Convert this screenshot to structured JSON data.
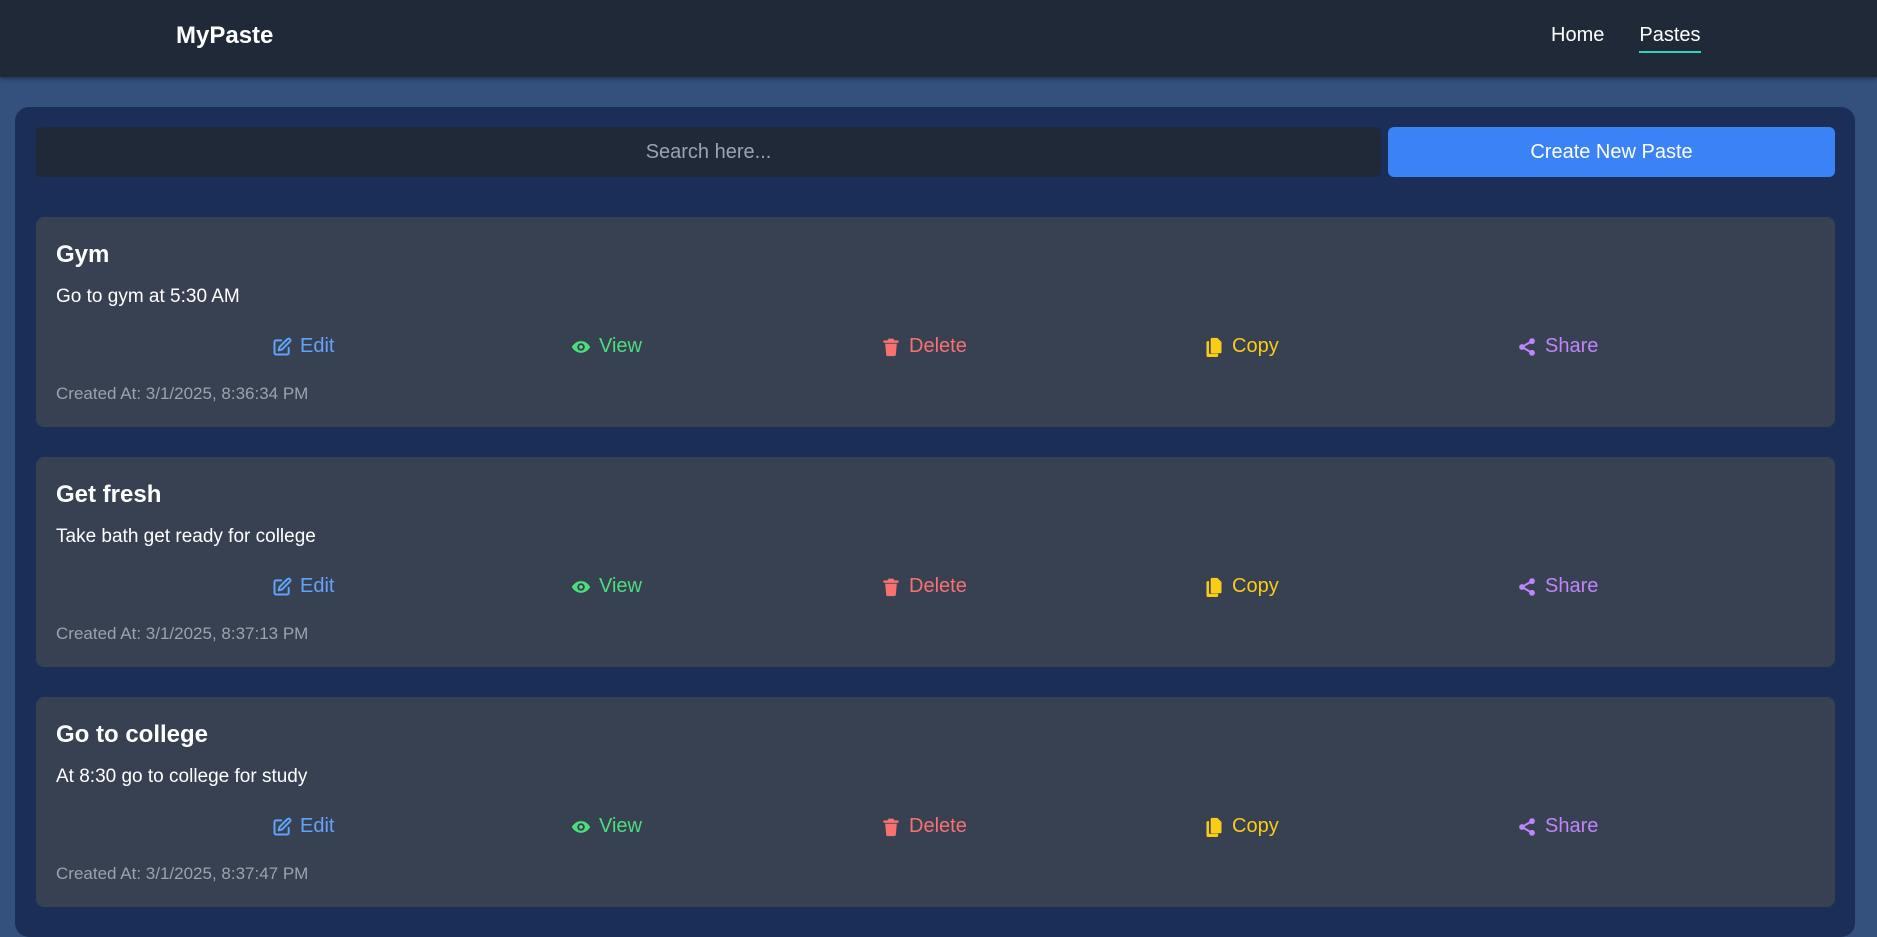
{
  "navbar": {
    "brand": "MyPaste",
    "links": [
      {
        "label": "Home"
      },
      {
        "label": "Pastes"
      }
    ]
  },
  "search": {
    "placeholder": "Search here..."
  },
  "create_button": "Create New Paste",
  "actions": {
    "edit": "Edit",
    "view": "View",
    "delete": "Delete",
    "copy": "Copy",
    "share": "Share"
  },
  "pastes": [
    {
      "title": "Gym",
      "content": "Go to gym at 5:30 AM",
      "created": "Created At: 3/1/2025, 8:36:34 PM"
    },
    {
      "title": "Get fresh",
      "content": "Take bath get ready for college",
      "created": "Created At: 3/1/2025, 8:37:13 PM"
    },
    {
      "title": "Go to college",
      "content": "At 8:30 go to college for study",
      "created": "Created At: 3/1/2025, 8:37:47 PM"
    }
  ],
  "colors": {
    "accent": "#3b82f6",
    "edit": "#60a5fa",
    "view": "#4ade80",
    "delete": "#f87171",
    "copy": "#facc15",
    "share": "#c084fc"
  }
}
